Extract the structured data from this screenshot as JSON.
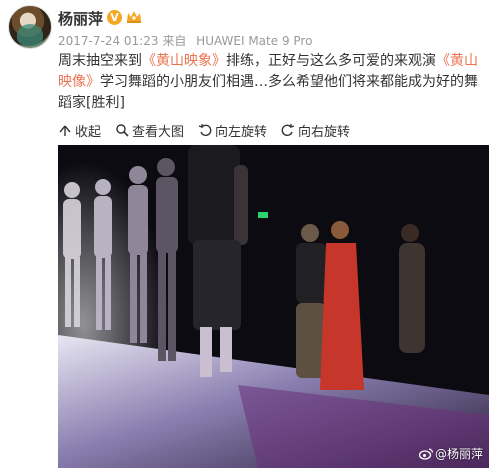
{
  "post": {
    "username": "杨丽萍",
    "verified_badge": "V",
    "timestamp": "2017-7-24 01:23",
    "source_prefix": "来自",
    "device": "HUAWEI Mate 9 Pro",
    "text_part1": "周末抽空来到",
    "link1": "《黄山映象》",
    "text_part2": "排练，正好与这么多可爱的来观演",
    "link2": "《黄山映像》",
    "text_part3": "学习舞蹈的小朋友们相遇…多么希望他们将来都能成为好的舞蹈家",
    "emoji": "[胜利]"
  },
  "actions": [
    {
      "label": "收起",
      "icon": "collapse-icon"
    },
    {
      "label": "查看大图",
      "icon": "magnifier-icon"
    },
    {
      "label": "向左旋转",
      "icon": "rotate-left-icon"
    },
    {
      "label": "向右旋转",
      "icon": "rotate-right-icon"
    }
  ],
  "photo": {
    "watermark": "@杨丽萍",
    "watermark_icon": "weibo-logo-icon"
  },
  "colors": {
    "link": "#eb7350",
    "meta": "#999999",
    "badge": "#f5a623"
  }
}
